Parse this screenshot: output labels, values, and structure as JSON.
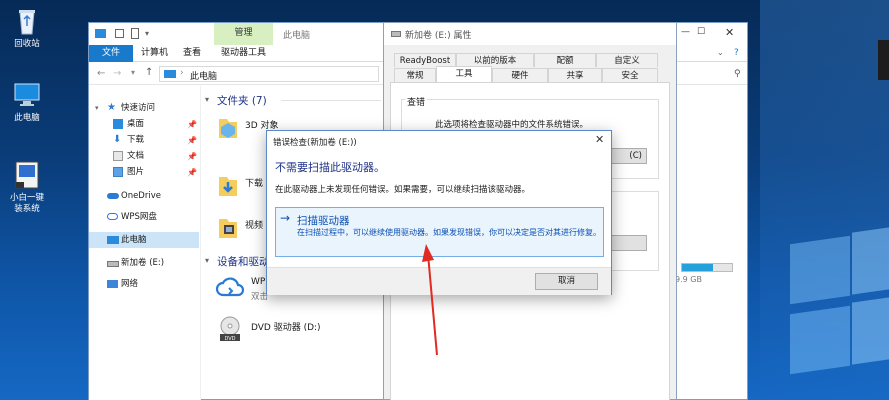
{
  "desktop": {
    "icons": [
      {
        "label": "回收站"
      },
      {
        "label": "此电脑"
      },
      {
        "label": "小白一键\n装系统"
      }
    ]
  },
  "explorer": {
    "ribbon": {
      "manage": "管理",
      "drive_name": "此电脑",
      "tabs": [
        "文件",
        "计算机",
        "查看",
        "驱动器工具"
      ]
    },
    "address": "此电脑",
    "nav": [
      {
        "label": "快速访问",
        "icon": "star-icon"
      },
      {
        "label": "桌面",
        "icon": "desktop-icon",
        "pinned": true
      },
      {
        "label": "下载",
        "icon": "download-icon",
        "pinned": true
      },
      {
        "label": "文档",
        "icon": "document-icon",
        "pinned": true
      },
      {
        "label": "图片",
        "icon": "picture-icon",
        "pinned": true
      },
      {
        "label": "OneDrive",
        "icon": "cloud-icon"
      },
      {
        "label": "WPS网盘",
        "icon": "wps-cloud-icon"
      },
      {
        "label": "此电脑",
        "icon": "computer-icon"
      },
      {
        "label": "新加卷 (E:)",
        "icon": "drive-icon"
      },
      {
        "label": "网络",
        "icon": "network-icon"
      }
    ],
    "folders_header": "文件夹 (7)",
    "folders": [
      {
        "name": "3D 对象"
      },
      {
        "name": "下载"
      },
      {
        "name": "视频"
      }
    ],
    "devices_header": "设备和驱动",
    "devices": [
      {
        "name": "WPS",
        "sub": "双击"
      },
      {
        "name": "DVD 驱动器 (D:)"
      }
    ],
    "free_text": "9.9 GB"
  },
  "properties": {
    "title": "新加卷 (E:) 属性",
    "tabs_row1": [
      "ReadyBoost",
      "以前的版本",
      "配额",
      "自定义"
    ],
    "tabs_row2": [
      "常规",
      "工具",
      "硬件",
      "共享",
      "安全"
    ],
    "section": "查错",
    "desc": "此选项将检查驱动器中的文件系统错误。",
    "check_btn": "(C)"
  },
  "dialog": {
    "title": "错误检查(新加卷 (E:))",
    "heading": "不需要扫描此驱动器。",
    "message": "在此驱动器上未发现任何错误。如果需要，可以继续扫描该驱动器。",
    "link_title": "扫描驱动器",
    "link_desc": "在扫描过程中，可以继续使用驱动器。如果发现错误，你可以决定是否对其进行修复。",
    "cancel": "取消"
  },
  "colors": {
    "accent": "#1979ca",
    "heading": "#1e3287",
    "link": "#0b4fb3",
    "arrow": "#e02a22"
  }
}
